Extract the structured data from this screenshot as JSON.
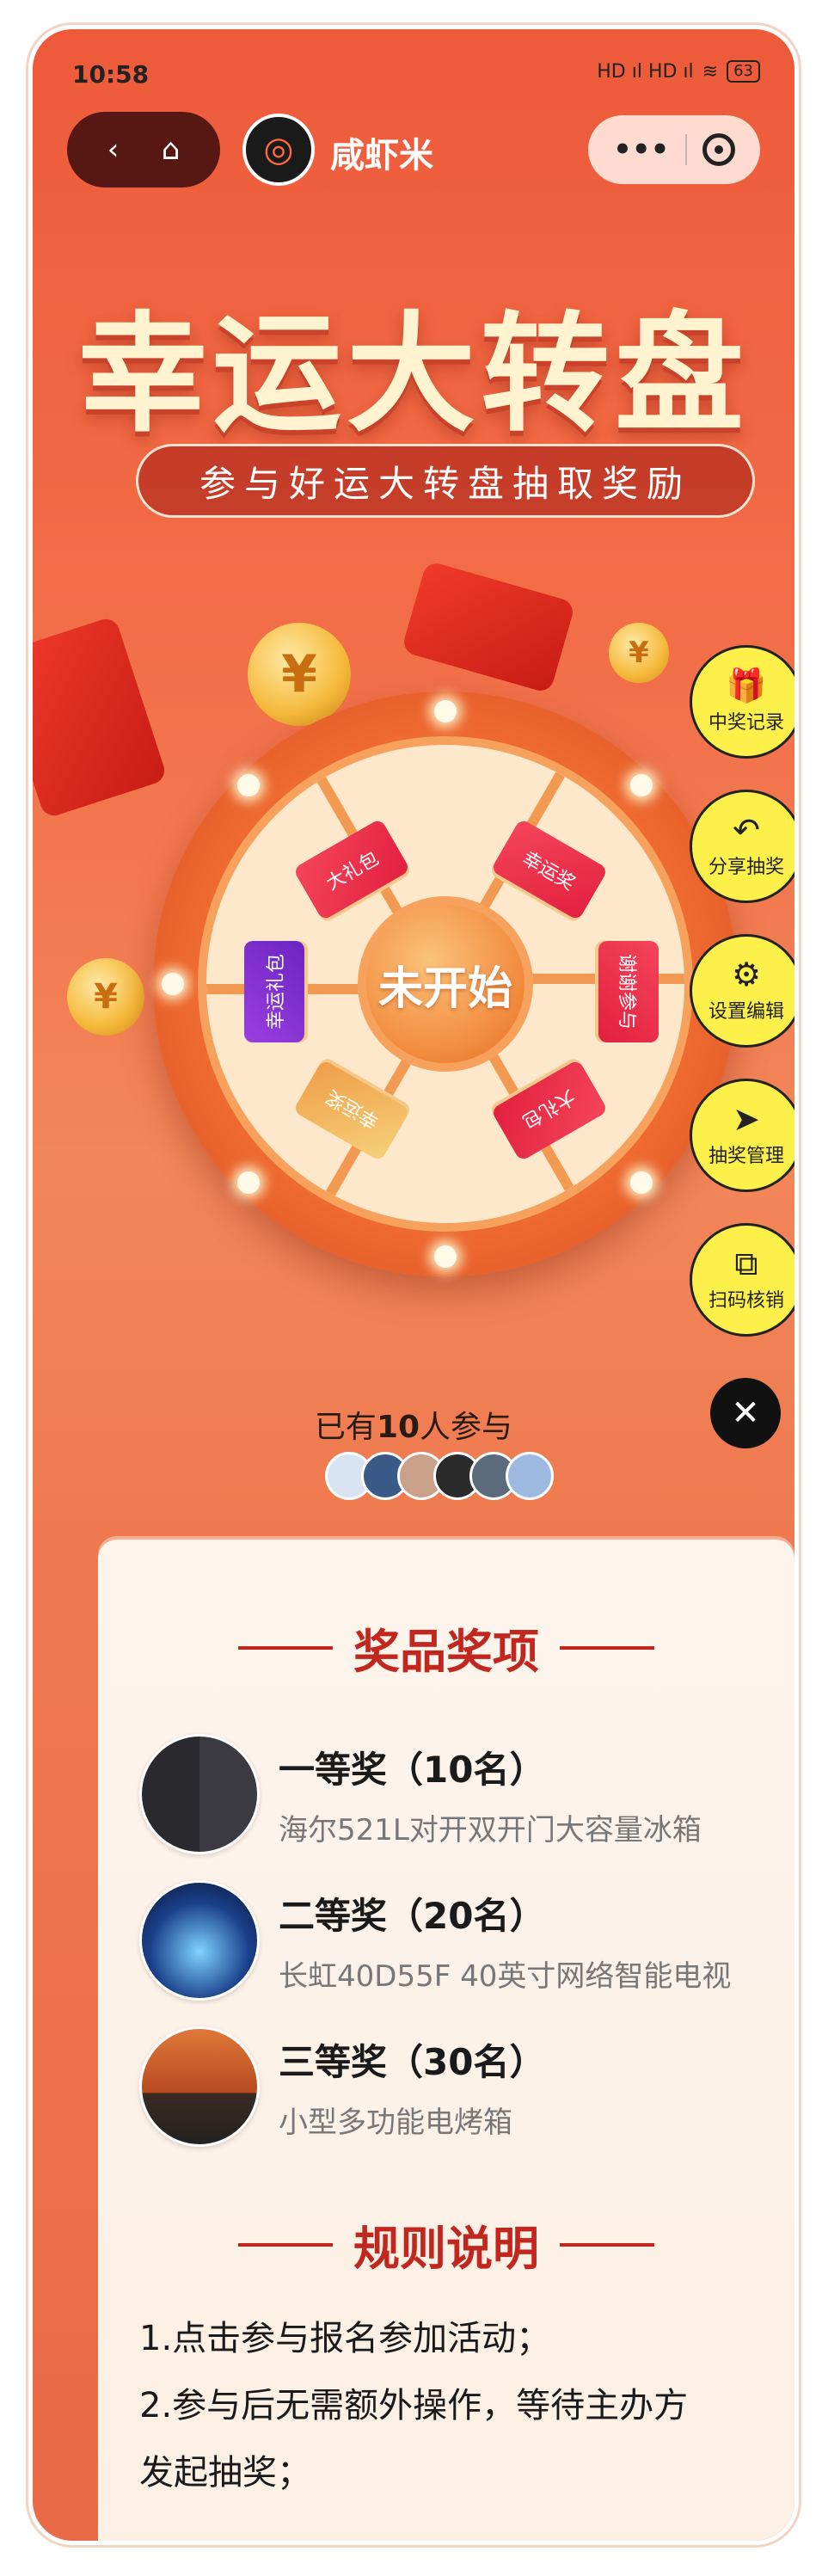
{
  "status": {
    "time": "10:58",
    "signal": "HD ıl HD ıl",
    "battery": "63"
  },
  "nav": {
    "brand": "咸虾米",
    "capsule_more": "•••"
  },
  "hero": {
    "title": "幸运大转盘",
    "subtitle": "参与好运大转盘抽取奖励"
  },
  "wheel": {
    "center_label": "未开始",
    "segments": [
      "幸运奖",
      "谢谢参与",
      "大礼包",
      "幸运奖",
      "幸运礼包",
      "大礼包"
    ]
  },
  "side_actions": [
    {
      "label": "中奖记录",
      "icon": "gift-icon"
    },
    {
      "label": "分享抽奖",
      "icon": "share-icon"
    },
    {
      "label": "设置编辑",
      "icon": "gear-icon"
    },
    {
      "label": "抽奖管理",
      "icon": "send-icon"
    },
    {
      "label": "扫码核销",
      "icon": "scan-icon"
    }
  ],
  "participants": {
    "prefix": "已有",
    "count": "10",
    "suffix": "人参与"
  },
  "prizes_section": {
    "title": "奖品奖项",
    "items": [
      {
        "name": "一等奖（10名）",
        "desc": "海尔521L对开双开门大容量冰箱"
      },
      {
        "name": "二等奖（20名）",
        "desc": "长虹40D55F 40英寸网络智能电视"
      },
      {
        "name": "三等奖（30名）",
        "desc": "小型多功能电烤箱"
      }
    ]
  },
  "rules_section": {
    "title": "规则说明",
    "lines": [
      "1.点击参与报名参加活动；",
      "2.参与后无需额外操作，等待主办方",
      "发起抽奖；"
    ]
  },
  "colors": {
    "accent": "#c2271f",
    "side_button": "#fdf04a",
    "background": "#ee5a3a"
  }
}
